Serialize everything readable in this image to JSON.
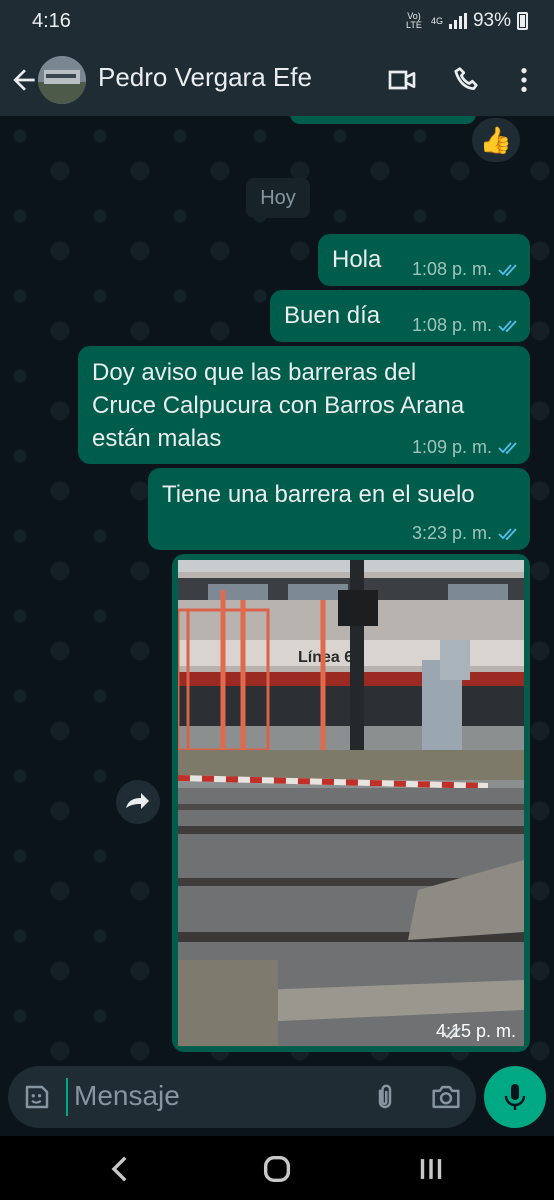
{
  "status_bar": {
    "time": "4:16",
    "volte": "Vo) LTE",
    "network": "4G",
    "battery": "93%"
  },
  "header": {
    "contact_name": "Pedro Vergara Efe",
    "icons": [
      "back-arrow-icon",
      "video-call-icon",
      "voice-call-icon",
      "more-options-icon"
    ]
  },
  "chat": {
    "reaction": "👍",
    "day_label": "Hoy",
    "messages": [
      {
        "text": "Hola",
        "time": "1:08 p. m."
      },
      {
        "text": "Buen día",
        "time": "1:08 p. m."
      },
      {
        "text": "Doy aviso que las barreras del Cruce Calpucura con Barros Arana están malas",
        "line1": "Doy aviso que las barreras del",
        "line2": "Cruce Calpucura con Barros Arana",
        "line3": "están malas",
        "time": "1:09 p. m."
      },
      {
        "text": "Tiene una barrera en el suelo",
        "time": "3:23 p. m."
      }
    ],
    "photo_message": {
      "time": "4:15 p. m.",
      "bus_sign": "Línea 6"
    }
  },
  "composer": {
    "placeholder": "Mensaje"
  },
  "colors": {
    "outgoing_bubble": "#005c4b",
    "accent": "#00a884",
    "background": "#0b141a",
    "bar": "#1f2c34",
    "read_ticks": "#53bdeb"
  }
}
